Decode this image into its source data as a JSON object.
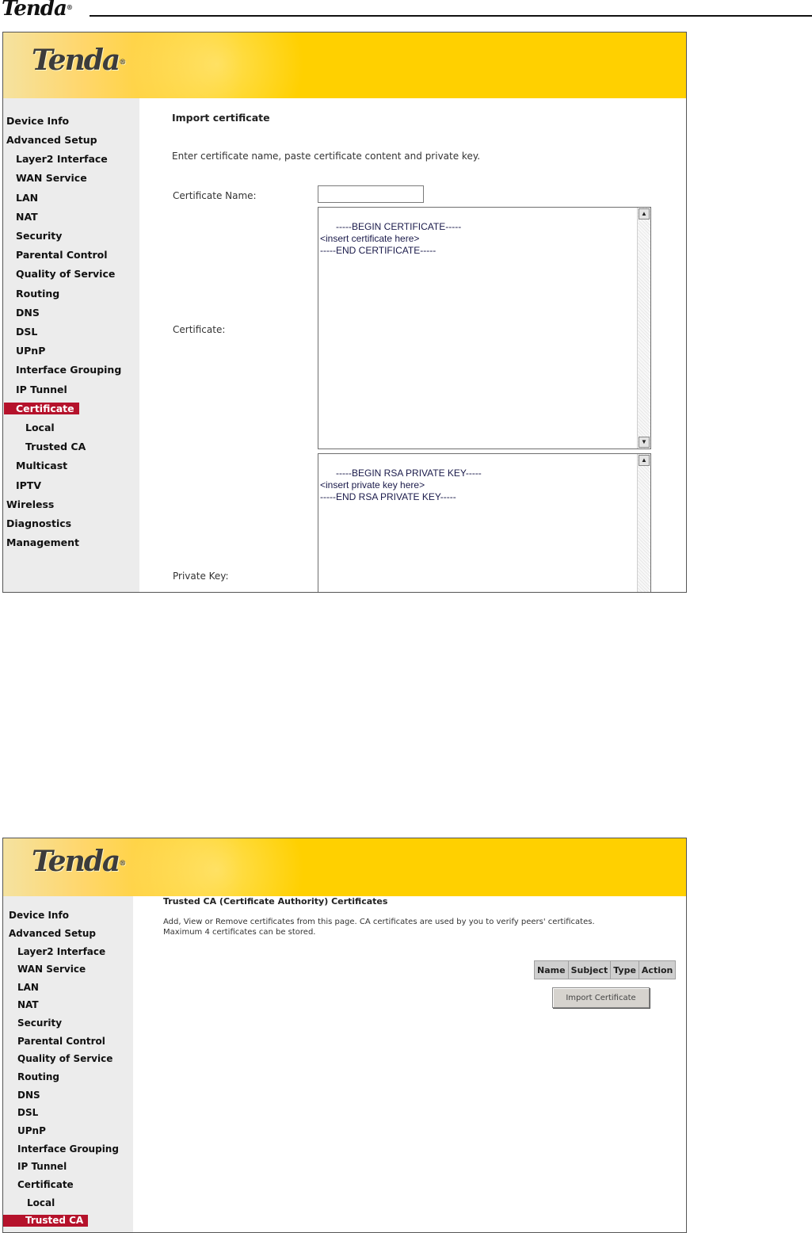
{
  "doc_header": {
    "logo": "Tenda",
    "reg": "®"
  },
  "screen1": {
    "banner_logo": "Tenda",
    "reg": "®",
    "nav": [
      {
        "label": "Device Info"
      },
      {
        "label": "Advanced Setup"
      },
      {
        "label": "Layer2 Interface"
      },
      {
        "label": "WAN Service"
      },
      {
        "label": "LAN"
      },
      {
        "label": "NAT"
      },
      {
        "label": "Security"
      },
      {
        "label": "Parental Control"
      },
      {
        "label": "Quality of Service"
      },
      {
        "label": "Routing"
      },
      {
        "label": "DNS"
      },
      {
        "label": "DSL"
      },
      {
        "label": "UPnP"
      },
      {
        "label": "Interface Grouping"
      },
      {
        "label": "IP Tunnel"
      },
      {
        "label": "Certificate",
        "active": true
      },
      {
        "label": "Local"
      },
      {
        "label": "Trusted CA"
      },
      {
        "label": "Multicast"
      },
      {
        "label": "IPTV"
      },
      {
        "label": "Wireless"
      },
      {
        "label": "Diagnostics"
      },
      {
        "label": "Management"
      }
    ],
    "title": "Import certificate",
    "description": "Enter certificate name, paste certificate content and private key.",
    "cert_name_label": "Certificate Name:",
    "cert_name_value": "",
    "certificate_label": "Certificate:",
    "certificate_value": "-----BEGIN CERTIFICATE-----\n<insert certificate here>\n-----END CERTIFICATE-----",
    "private_key_label": "Private Key:",
    "private_key_value": "-----BEGIN RSA PRIVATE KEY-----\n<insert private key here>\n-----END RSA PRIVATE KEY-----",
    "scroll_up_icon": "▲",
    "scroll_down_icon": "▼"
  },
  "screen2": {
    "banner_logo": "Tenda",
    "reg": "®",
    "nav": [
      {
        "label": "Device Info"
      },
      {
        "label": "Advanced Setup"
      },
      {
        "label": "Layer2 Interface"
      },
      {
        "label": "WAN Service"
      },
      {
        "label": "LAN"
      },
      {
        "label": "NAT"
      },
      {
        "label": "Security"
      },
      {
        "label": "Parental Control"
      },
      {
        "label": "Quality of Service"
      },
      {
        "label": "Routing"
      },
      {
        "label": "DNS"
      },
      {
        "label": "DSL"
      },
      {
        "label": "UPnP"
      },
      {
        "label": "Interface Grouping"
      },
      {
        "label": "IP Tunnel"
      },
      {
        "label": "Certificate"
      },
      {
        "label": "Local"
      },
      {
        "label": "Trusted CA",
        "active": true
      }
    ],
    "title": "Trusted CA (Certificate Authority) Certificates",
    "description_line1": "Add, View or Remove certificates from this page. CA certificates are used by you to verify peers' certificates.",
    "description_line2": "Maximum 4 certificates can be stored.",
    "table_headers": [
      "Name",
      "Subject",
      "Type",
      "Action"
    ],
    "import_button": "Import Certificate"
  }
}
